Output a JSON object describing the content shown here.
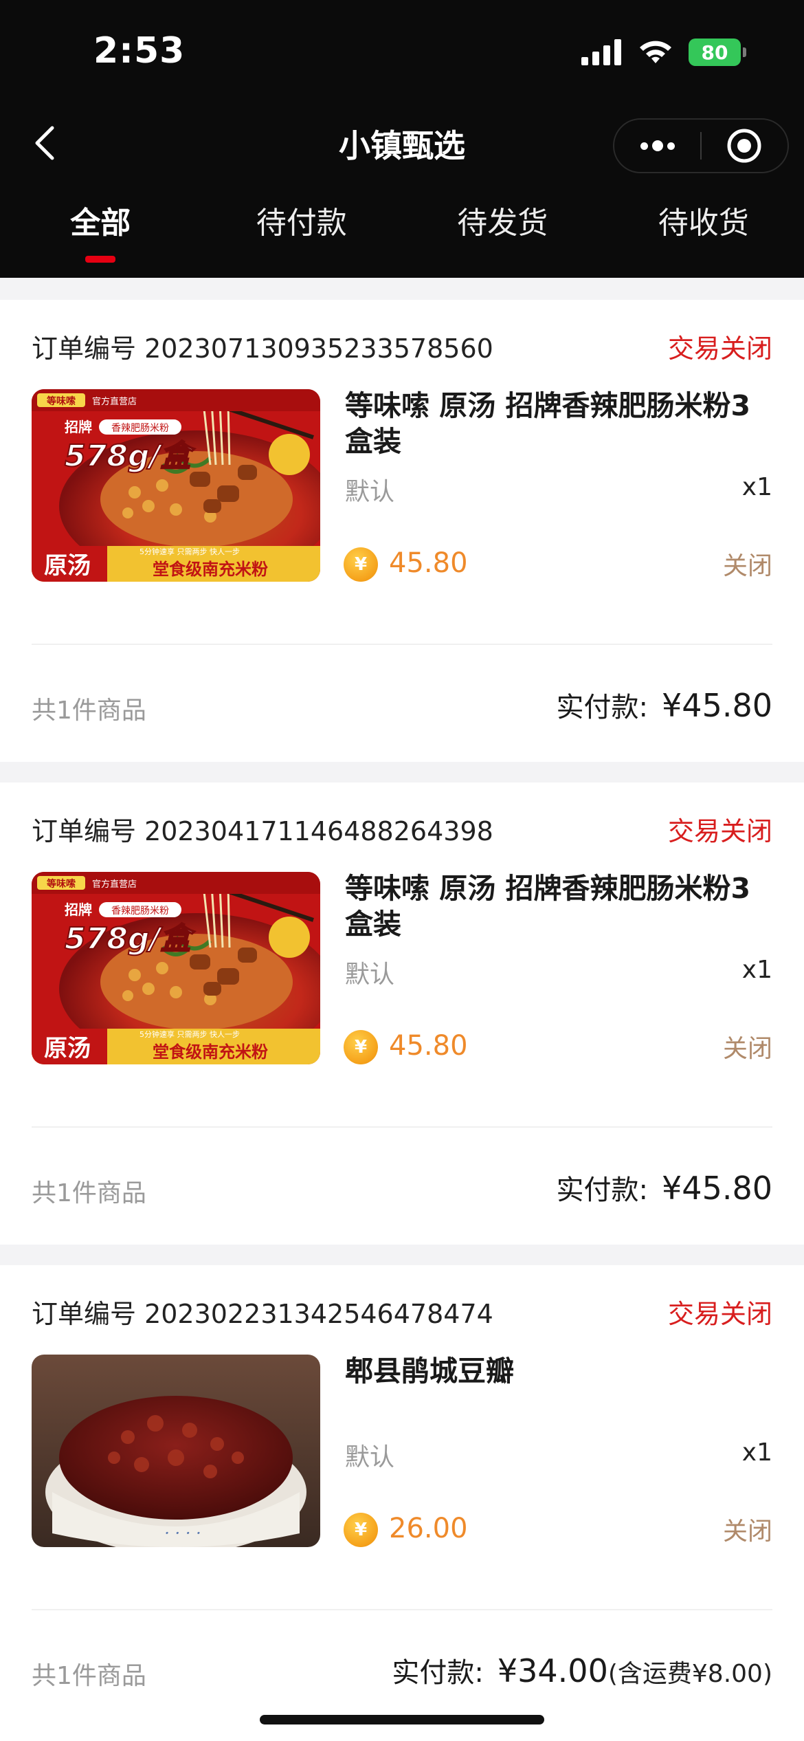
{
  "status_bar": {
    "time": "2:53",
    "battery": "80"
  },
  "nav": {
    "title": "小镇甄选",
    "back_icon": "chevron-left-icon",
    "more_icon": "more-dots-icon",
    "close_icon": "target-circle-icon"
  },
  "tabs": [
    {
      "label": "全部",
      "active": true
    },
    {
      "label": "待付款",
      "active": false
    },
    {
      "label": "待发货",
      "active": false
    },
    {
      "label": "待收货",
      "active": false
    }
  ],
  "orders": [
    {
      "order_no": "订单编号 20230713093523357856​0",
      "status": "交易关闭",
      "product_name": "等味嗦 原汤 招牌香辣肥肠米粉3盒装",
      "spec": "默认",
      "qty": "x1",
      "price": "45.80",
      "item_state": "关闭",
      "count_text": "共1件商品",
      "paid_label": "实付款:",
      "paid_amount": "¥45.80",
      "shipping_note": "",
      "image": {
        "brand": "等味嗦",
        "shop": "官方直营店",
        "tag1": "招牌",
        "tag2": "香辣肥肠米粉",
        "weight": "578g/盒",
        "bottom_left": "原汤",
        "bottom_tip": "5分钟速享 只需两步 快人一步",
        "bottom_right": "堂食级南充米粉"
      }
    },
    {
      "order_no": "订单编号 20230417114648826439​8",
      "status": "交易关闭",
      "product_name": "等味嗦 原汤 招牌香辣肥肠米粉3盒装",
      "spec": "默认",
      "qty": "x1",
      "price": "45.80",
      "item_state": "关闭",
      "count_text": "共1件商品",
      "paid_label": "实付款:",
      "paid_amount": "¥45.80",
      "shipping_note": "",
      "image": {
        "brand": "等味嗦",
        "shop": "官方直营店",
        "tag1": "招牌",
        "tag2": "香辣肥肠米粉",
        "weight": "578g/盒",
        "bottom_left": "原汤",
        "bottom_tip": "5分钟速享 只需两步 快人一步",
        "bottom_right": "堂食级南充米粉"
      }
    },
    {
      "order_no": "订单编号 20230223134254647847​4",
      "status": "交易关闭",
      "product_name": "郫县鹃城豆瓣",
      "spec": "默认",
      "qty": "x1",
      "price": "26.00",
      "item_state": "关闭",
      "count_text": "共1件商品",
      "paid_label": "实付款:",
      "paid_amount": "¥34.00",
      "shipping_note": "(含运费¥8.00)",
      "image": null
    }
  ],
  "colors": {
    "header_bg": "#0b0b0b",
    "accent_red": "#e60012",
    "status_red": "#d81e1e",
    "price_orange": "#ef8a2a"
  }
}
